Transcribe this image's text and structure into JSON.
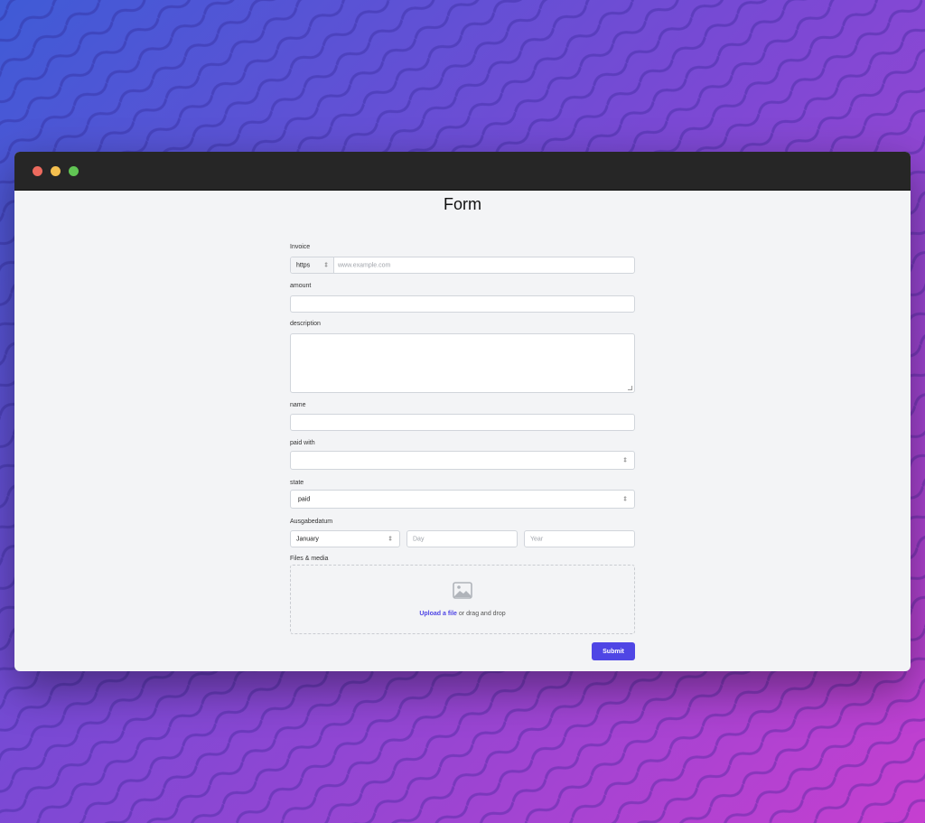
{
  "page": {
    "title": "Form"
  },
  "form": {
    "invoice": {
      "label": "Invoice",
      "protocol": "https",
      "placeholder": "www.example.com"
    },
    "amount": {
      "label": "amount",
      "value": ""
    },
    "description": {
      "label": "description",
      "value": ""
    },
    "name": {
      "label": "name",
      "value": ""
    },
    "paid_with": {
      "label": "paid with",
      "value": ""
    },
    "state": {
      "label": "state",
      "value": "paid"
    },
    "date": {
      "label": "Ausgabedatum",
      "month": "January",
      "day_placeholder": "Day",
      "year_placeholder": "Year"
    },
    "files": {
      "label": "Files & media",
      "upload_link": "Upload a file",
      "upload_hint": "or drag and drop"
    },
    "submit_label": "Submit"
  },
  "colors": {
    "accent": "#4f46e5",
    "titlebar": "#262626"
  },
  "icons": {
    "window_close": "red-dot",
    "window_minimize": "yellow-dot",
    "window_maximize": "green-dot",
    "upload": "image-icon"
  }
}
